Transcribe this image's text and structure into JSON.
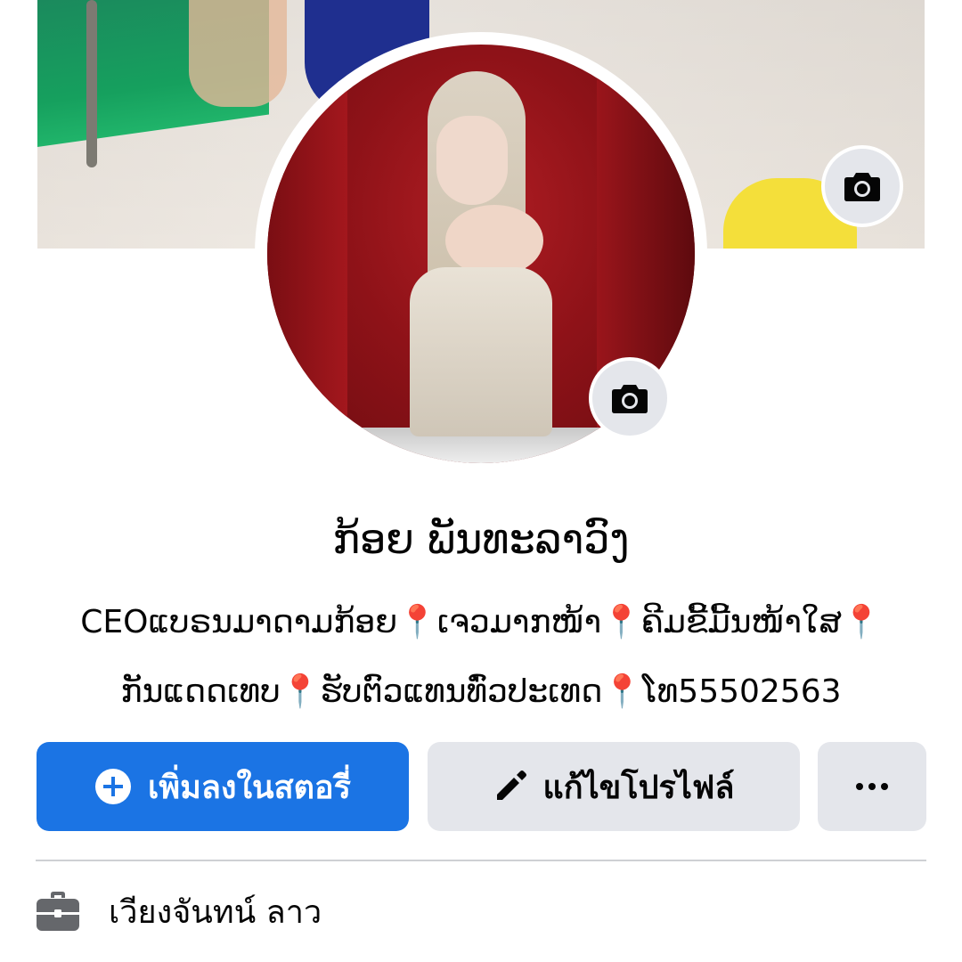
{
  "profile": {
    "name": "ກ້ອຍ ພັນທະລາວົງ",
    "bio_line1": "CEOແບຣນມາດາມກ້ອຍ📍ເຈວມາກໜ້າ📍ຄີມຂີ້ມີ້ນໜ້າໃສ📍",
    "bio_line2": "ກັນແດດເທບ📍ຮັບຕົວແທນທົ່ວປະເທດ📍ໂທ55502563"
  },
  "actions": {
    "add_story_label": "เพิ่มลงในสตอรี่",
    "edit_profile_label": "แก้ไขโปรไฟล์",
    "more_label": "···"
  },
  "details": {
    "work_text": "เวียงจันทน์ ลาว"
  },
  "colors": {
    "primary": "#1b74e4",
    "secondary_button": "#e4e6eb",
    "text": "#050505",
    "divider": "#ced0d4"
  },
  "icons": {
    "cover_camera": "camera-icon",
    "avatar_camera": "camera-icon",
    "add_story": "plus-circle-icon",
    "edit_profile": "pencil-icon",
    "more": "ellipsis-icon",
    "work": "briefcase-icon"
  }
}
